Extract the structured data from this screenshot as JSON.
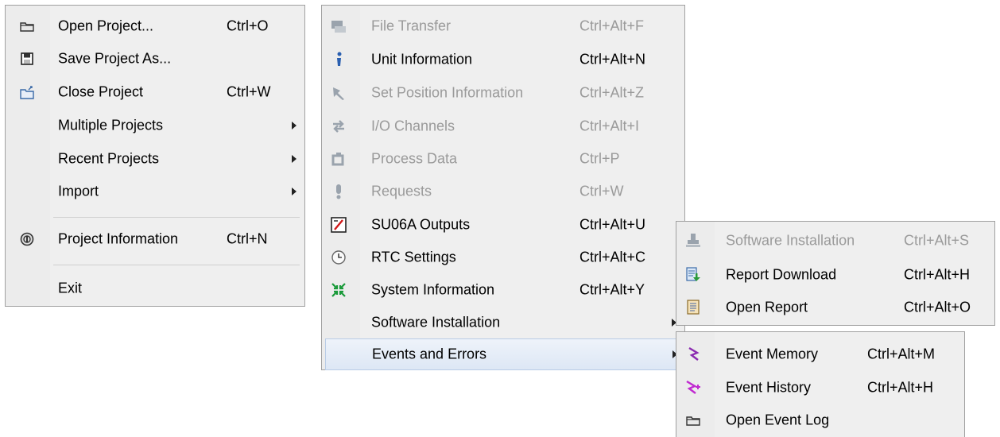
{
  "menu1": {
    "items": [
      {
        "label": "Open Project...",
        "shortcut": "Ctrl+O",
        "icon": "folder-open-icon"
      },
      {
        "label": "Save Project As...",
        "shortcut": "",
        "icon": "floppy-disk-icon"
      },
      {
        "label": "Close Project",
        "shortcut": "Ctrl+W",
        "icon": "folder-close-icon"
      },
      {
        "label": "Multiple Projects",
        "shortcut": "",
        "icon": ""
      },
      {
        "label": "Recent Projects",
        "shortcut": "",
        "icon": ""
      },
      {
        "label": "Import",
        "shortcut": "",
        "icon": ""
      },
      {
        "label": "Project Information",
        "shortcut": "Ctrl+N",
        "icon": "info-circle-icon"
      },
      {
        "label": "Exit",
        "shortcut": "",
        "icon": ""
      }
    ]
  },
  "menu2": {
    "items": [
      {
        "label": "File Transfer",
        "shortcut": "Ctrl+Alt+F",
        "disabled": true
      },
      {
        "label": "Unit Information",
        "shortcut": "Ctrl+Alt+N",
        "disabled": false
      },
      {
        "label": "Set Position Information",
        "shortcut": "Ctrl+Alt+Z",
        "disabled": true
      },
      {
        "label": "I/O Channels",
        "shortcut": "Ctrl+Alt+I",
        "disabled": true
      },
      {
        "label": "Process Data",
        "shortcut": "Ctrl+P",
        "disabled": true
      },
      {
        "label": "Requests",
        "shortcut": "Ctrl+W",
        "disabled": true
      },
      {
        "label": "SU06A Outputs",
        "shortcut": "Ctrl+Alt+U",
        "disabled": false
      },
      {
        "label": "RTC Settings",
        "shortcut": "Ctrl+Alt+C",
        "disabled": false
      },
      {
        "label": "System Information",
        "shortcut": "Ctrl+Alt+Y",
        "disabled": false
      },
      {
        "label": "Software Installation",
        "shortcut": "",
        "disabled": false
      },
      {
        "label": "Events and Errors",
        "shortcut": "",
        "disabled": false
      }
    ]
  },
  "menu3": {
    "items": [
      {
        "label": "Software Installation",
        "shortcut": "Ctrl+Alt+S",
        "disabled": true
      },
      {
        "label": "Report Download",
        "shortcut": "Ctrl+Alt+H",
        "disabled": false
      },
      {
        "label": "Open Report",
        "shortcut": "Ctrl+Alt+O",
        "disabled": false
      }
    ]
  },
  "menu4": {
    "items": [
      {
        "label": "Event Memory",
        "shortcut": "Ctrl+Alt+M"
      },
      {
        "label": "Event History",
        "shortcut": "Ctrl+Alt+H"
      },
      {
        "label": "Open Event Log",
        "shortcut": ""
      }
    ]
  }
}
